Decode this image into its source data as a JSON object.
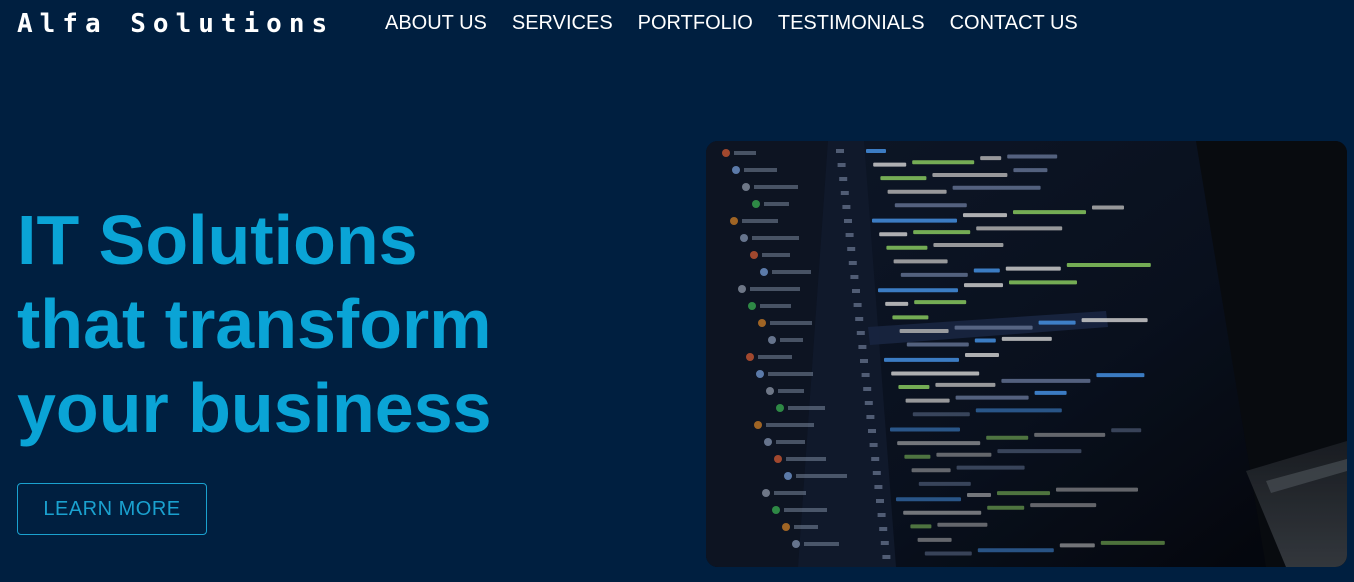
{
  "brand": {
    "name": "Alfa Solutions"
  },
  "nav": {
    "items": [
      {
        "label": "ABOUT US"
      },
      {
        "label": "SERVICES"
      },
      {
        "label": "PORTFOLIO"
      },
      {
        "label": "TESTIMONIALS"
      },
      {
        "label": "CONTACT US"
      }
    ]
  },
  "hero": {
    "headline_lines": [
      "IT Solutions",
      "that transform",
      "your business"
    ],
    "cta_label": "LEARN MORE",
    "image_subject": "laptop-screen-with-code"
  },
  "colors": {
    "background": "#001f40",
    "accent": "#0aa4d6",
    "text": "#ffffff"
  }
}
